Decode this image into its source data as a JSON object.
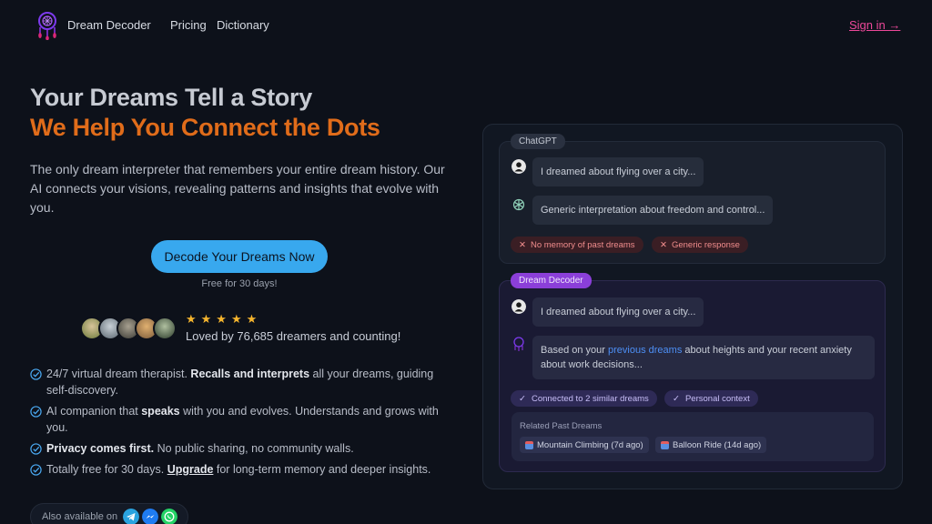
{
  "header": {
    "brand": "Dream Decoder",
    "nav": [
      "Pricing",
      "Dictionary"
    ],
    "signin": "Sign in →"
  },
  "hero": {
    "title_line1": "Your Dreams Tell a Story",
    "title_line2": "We Help You Connect the Dots",
    "description": "The only dream interpreter that remembers your entire dream history. Our AI connects your visions, revealing patterns and insights that evolve with you.",
    "cta": "Decode Your Dreams Now",
    "cta_sub": "Free for 30 days!",
    "stars": "★★★★★",
    "social_proof": "Loved by 76,685 dreamers and counting!"
  },
  "features": [
    {
      "pre": "24/7 virtual dream therapist. ",
      "bold": "Recalls and interprets",
      "post": " all your dreams, guiding self-discovery."
    },
    {
      "pre": "AI companion that ",
      "bold": "speaks",
      "post": " with you and evolves. Understands and grows with you."
    },
    {
      "pre": "",
      "bold": "Privacy comes first.",
      "post": " No public sharing, no community walls."
    },
    {
      "pre": "Totally free for 30 days. ",
      "bold": "Upgrade",
      "post": " for long-term memory and deeper insights."
    }
  ],
  "available": {
    "label": "Also available on",
    "apps": [
      "telegram-icon",
      "messenger-icon",
      "whatsapp-icon"
    ]
  },
  "comparison": {
    "chatgpt": {
      "tag": "ChatGPT",
      "user_msg": "I dreamed about flying over a city...",
      "bot_msg": "Generic interpretation about freedom and control...",
      "cons": [
        "No memory of past dreams",
        "Generic response"
      ]
    },
    "dreamdecoder": {
      "tag": "Dream Decoder",
      "user_msg": "I dreamed about flying over a city...",
      "bot_pre": "Based on your ",
      "bot_link": "previous dreams",
      "bot_post": " about heights and your recent anxiety about work decisions...",
      "pros": [
        "Connected to 2 similar dreams",
        "Personal context"
      ],
      "related_label": "Related Past Dreams",
      "related": [
        "Mountain Climbing (7d ago)",
        "Balloon Ride (14d ago)"
      ]
    }
  },
  "colors": {
    "background": "#0d111a",
    "accent_orange": "#e06c1a",
    "cta_blue": "#38a8ee",
    "signin_pink": "#ec4899",
    "dd_purple": "#8b3fd9"
  }
}
